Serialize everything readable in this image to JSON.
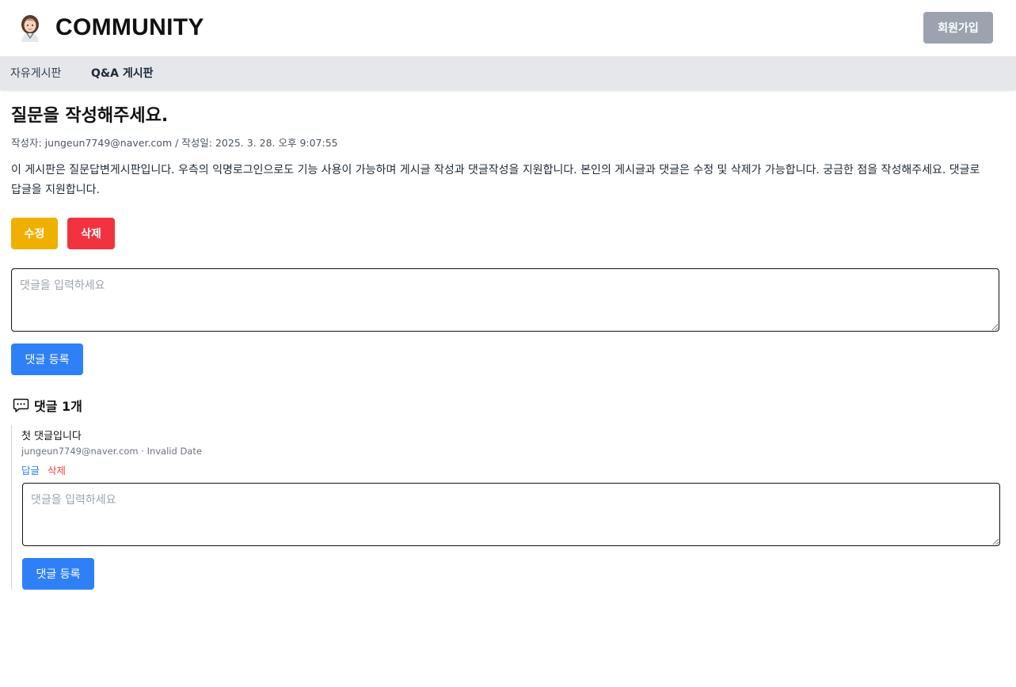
{
  "header": {
    "site_title": "COMMUNITY",
    "signup_label": "회원가입",
    "logo_icon": "avatar-logo-icon"
  },
  "nav": {
    "items": [
      {
        "label": "자유게시판",
        "active": false
      },
      {
        "label": "Q&A 게시판",
        "active": true
      }
    ]
  },
  "post": {
    "title": "질문을 작성해주세요.",
    "meta": "작성자: jungeun7749@naver.com / 작성일: 2025. 3. 28. 오후 9:07:55",
    "body": "이 게시판은 질문답변게시판입니다. 우측의 익명로그인으로도 기능 사용이 가능하며 게시글 작성과 댓글작성을 지원합니다. 본인의 게시글과 댓글은 수정 및 삭제가 가능합니다. 궁금한 점을 작성해주세요. 댓글로 답글을 지원합니다.",
    "edit_label": "수정",
    "delete_label": "삭제"
  },
  "comment_form": {
    "placeholder": "댓글을 입력하세요",
    "submit_label": "댓글 등록"
  },
  "comments": {
    "header_label": "댓글 1개",
    "header_icon": "chat-bubble-icon",
    "items": [
      {
        "text": "첫 댓글입니다",
        "meta": "jungeun7749@naver.com · Invalid Date",
        "reply_label": "답글",
        "delete_label": "삭제",
        "reply_placeholder": "댓글을 입력하세요",
        "reply_submit_label": "댓글 등록"
      }
    ]
  },
  "colors": {
    "signup_button": "#9ca3af",
    "edit_button": "#f0b000",
    "delete_button": "#f2333f",
    "primary_button": "#2f80f6",
    "nav_background": "#e5e7eb"
  }
}
